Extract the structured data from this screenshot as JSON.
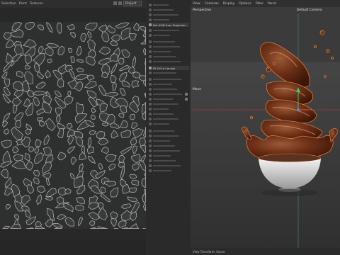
{
  "uv_editor": {
    "menu": [
      "Selection",
      "Paint",
      "Textures"
    ],
    "mode_value": "Project",
    "colors": {
      "island_stroke": "#b9b9b9",
      "background": "#2e2f2f"
    }
  },
  "tool_panel": {
    "items": [
      {
        "label": "Set UVW from Projection",
        "highlight": true
      },
      {
        "label": "Fit UV to Canvas",
        "highlight": true
      }
    ]
  },
  "viewport": {
    "menu": [
      "View",
      "Cameras",
      "Display",
      "Options",
      "Filter",
      "Panel"
    ],
    "view_name": "Perspective",
    "camera_name": "Default Camera",
    "move_label": "Move",
    "status": "View Transform: Scene",
    "colors": {
      "chocolate": "#6b2f16",
      "selection_outline": "#e07a2e",
      "bowl": "#e2e2e2",
      "x_axis": "#c0392b"
    }
  }
}
